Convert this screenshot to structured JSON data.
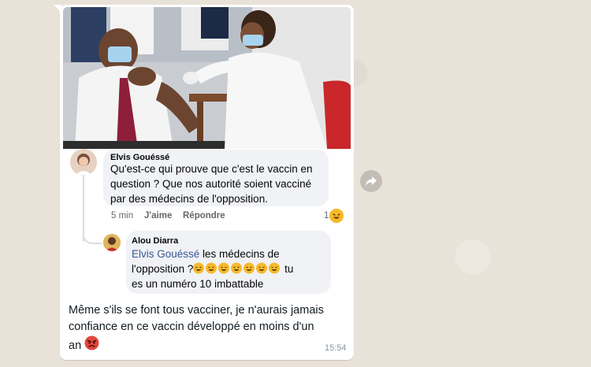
{
  "message": {
    "embedded_post": {
      "comment_1": {
        "author": "Elvis Gouéssé",
        "text_line1": "Qu'est-ce qui prouve que c'est le vaccin en",
        "text_line2": "question ? Que nos autorité soient vacciné",
        "text_line3": "par des médecins de l'opposition.",
        "time": "5 min",
        "like_label": "J'aime",
        "reply_label": "Répondre",
        "reaction_count": "1"
      },
      "comment_2": {
        "author": "Alou Diarra",
        "mention": "Elvis Gouéssé",
        "text_part1": " les médecins de",
        "text_line2_start": "l'opposition ?",
        "text_line2_end": " tu",
        "text_line3": "es un numéro 10 imbattable"
      }
    },
    "caption_line1": "Même s'ils se font tous vacciner, je n'aurais jamais",
    "caption_line2": "confiance en ce vaccin développé en moins d'un",
    "caption_line3": "an",
    "timestamp": "15:54"
  },
  "icons": {
    "forward": "forward-icon",
    "laugh": "laughing-emoji-icon",
    "angry": "angry-emoji-icon"
  },
  "colors": {
    "bubble": "#ffffff",
    "background": "#e9e2d9",
    "comment_bg": "#f0f2f5",
    "mention": "#385898"
  }
}
